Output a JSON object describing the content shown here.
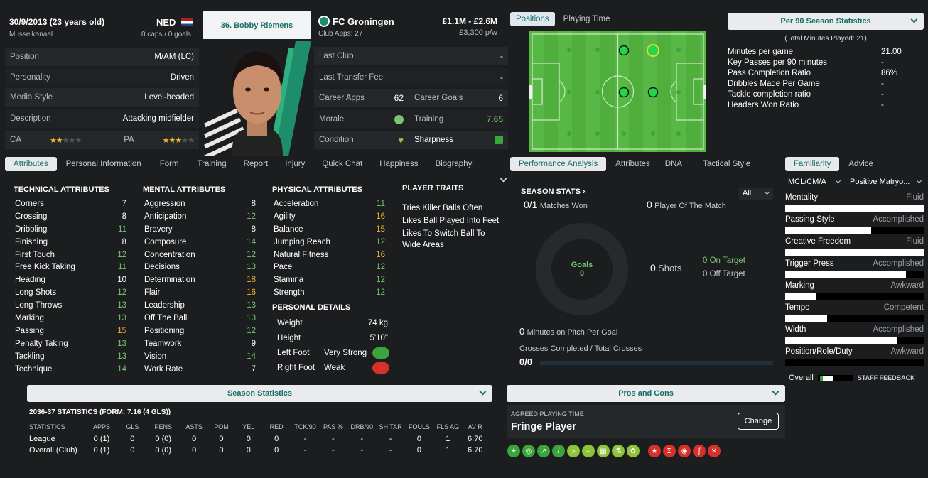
{
  "header": {
    "dob": "30/9/2013 (23 years old)",
    "nation": "NED",
    "birthplace": "Musselkanaal",
    "caps": "0 caps / 0 goals",
    "player_name": "36. Bobby Riemens",
    "club": "FC Groningen",
    "club_apps": "Club Apps: 27",
    "value": "£1.1M - £2.6M",
    "wage": "£3,300 p/w"
  },
  "info_rows": [
    {
      "label": "Position",
      "value": "M/AM (LC)"
    },
    {
      "label": "Personality",
      "value": "Driven"
    },
    {
      "label": "Media Style",
      "value": "Level-headed"
    },
    {
      "label": "Description",
      "value": "Attacking midfielder"
    }
  ],
  "ability": {
    "ca_label": "CA",
    "pa_label": "PA",
    "ca_stars": 2.5,
    "pa_stars": 3.5
  },
  "club_rows": {
    "last_club_label": "Last Club",
    "last_club": "-",
    "last_fee_label": "Last Transfer Fee",
    "last_fee": "-",
    "career_apps_label": "Career Apps",
    "career_apps": "62",
    "career_goals_label": "Career Goals",
    "career_goals": "6",
    "morale_label": "Morale",
    "training_label": "Training",
    "training": "7.65",
    "condition_label": "Condition",
    "sharpness_label": "Sharpness"
  },
  "pitch_tabs": [
    "Positions",
    "Playing Time"
  ],
  "per90": {
    "title": "Per 90 Season Statistics",
    "subtitle": "(Total Minutes Played: 21)",
    "rows": [
      {
        "label": "Minutes per game",
        "value": "21.00"
      },
      {
        "label": "Key Passes per 90 minutes",
        "value": "-"
      },
      {
        "label": "Pass Completion Ratio",
        "value": "86%"
      },
      {
        "label": "Dribbles Made Per Game",
        "value": "-"
      },
      {
        "label": "Tackle completion ratio",
        "value": "-"
      },
      {
        "label": "Headers Won Ratio",
        "value": "-"
      }
    ]
  },
  "tabs": [
    "Attributes",
    "Personal Information",
    "Form",
    "Training",
    "Report",
    "Injury",
    "Quick Chat",
    "Happiness",
    "Biography"
  ],
  "technical": {
    "title": "TECHNICAL ATTRIBUTES",
    "items": [
      {
        "n": "Corners",
        "v": "7"
      },
      {
        "n": "Crossing",
        "v": "8"
      },
      {
        "n": "Dribbling",
        "v": "11"
      },
      {
        "n": "Finishing",
        "v": "8"
      },
      {
        "n": "First Touch",
        "v": "12"
      },
      {
        "n": "Free Kick Taking",
        "v": "11"
      },
      {
        "n": "Heading",
        "v": "10"
      },
      {
        "n": "Long Shots",
        "v": "12"
      },
      {
        "n": "Long Throws",
        "v": "13"
      },
      {
        "n": "Marking",
        "v": "13"
      },
      {
        "n": "Passing",
        "v": "15"
      },
      {
        "n": "Penalty Taking",
        "v": "13"
      },
      {
        "n": "Tackling",
        "v": "13"
      },
      {
        "n": "Technique",
        "v": "14"
      }
    ]
  },
  "mental": {
    "title": "MENTAL ATTRIBUTES",
    "items": [
      {
        "n": "Aggression",
        "v": "8"
      },
      {
        "n": "Anticipation",
        "v": "12"
      },
      {
        "n": "Bravery",
        "v": "8"
      },
      {
        "n": "Composure",
        "v": "14"
      },
      {
        "n": "Concentration",
        "v": "12"
      },
      {
        "n": "Decisions",
        "v": "13"
      },
      {
        "n": "Determination",
        "v": "18"
      },
      {
        "n": "Flair",
        "v": "16"
      },
      {
        "n": "Leadership",
        "v": "13"
      },
      {
        "n": "Off The Ball",
        "v": "13"
      },
      {
        "n": "Positioning",
        "v": "12"
      },
      {
        "n": "Teamwork",
        "v": "9"
      },
      {
        "n": "Vision",
        "v": "14"
      },
      {
        "n": "Work Rate",
        "v": "7"
      }
    ]
  },
  "physical": {
    "title": "PHYSICAL ATTRIBUTES",
    "items": [
      {
        "n": "Acceleration",
        "v": "11"
      },
      {
        "n": "Agility",
        "v": "16"
      },
      {
        "n": "Balance",
        "v": "15"
      },
      {
        "n": "Jumping Reach",
        "v": "12"
      },
      {
        "n": "Natural Fitness",
        "v": "16"
      },
      {
        "n": "Pace",
        "v": "12"
      },
      {
        "n": "Stamina",
        "v": "12"
      },
      {
        "n": "Strength",
        "v": "12"
      }
    ]
  },
  "personal": {
    "title": "PERSONAL DETAILS",
    "weight_label": "Weight",
    "weight": "74 kg",
    "height_label": "Height",
    "height": "5'10\"",
    "left_label": "Left Foot",
    "left": "Very Strong",
    "right_label": "Right Foot",
    "right": "Weak"
  },
  "traits": {
    "title": "PLAYER TRAITS",
    "items": [
      "Tries Killer Balls Often",
      "Likes Ball Played Into Feet",
      "Likes To Switch Ball To Wide Areas"
    ]
  },
  "perf_tabs": [
    "Performance Analysis",
    "Attributes",
    "DNA",
    "Tactical Style"
  ],
  "season_stats": {
    "title": "SEASON STATS",
    "filter": "All",
    "matches_won_v": "0/1",
    "matches_won": "Matches Won",
    "potm_v": "0",
    "potm": "Player Of The Match",
    "goals_label": "Goals",
    "goals": "0",
    "shots_v": "0",
    "shots": "Shots",
    "on_target_v": "0",
    "on_target": "On Target",
    "off_target_v": "0",
    "off_target": "Off Target",
    "mins_goal_v": "0",
    "mins_goal": "Minutes on Pitch Per Goal",
    "crosses_label": "Crosses Completed / Total Crosses",
    "crosses": "0/0"
  },
  "fam_tabs": [
    "Familiarity",
    "Advice"
  ],
  "familiarity": {
    "pos_select": "MCL/CM/A",
    "role_select": "Positive Matryo...",
    "items": [
      {
        "n": "Mentality",
        "v": "Fluid",
        "f": 1.0
      },
      {
        "n": "Passing Style",
        "v": "Accomplished",
        "f": 0.62
      },
      {
        "n": "Creative Freedom",
        "v": "Fluid",
        "f": 1.0
      },
      {
        "n": "Trigger Press",
        "v": "Accomplished",
        "f": 0.87
      },
      {
        "n": "Marking",
        "v": "Awkward",
        "f": 0.22
      },
      {
        "n": "Tempo",
        "v": "Competent",
        "f": 0.3
      },
      {
        "n": "Width",
        "v": "Accomplished",
        "f": 0.81
      },
      {
        "n": "Position/Role/Duty",
        "v": "Awkward",
        "f": 0.0
      }
    ],
    "overall": "Overall",
    "staff_feedback": "STAFF FEEDBACK"
  },
  "season_statistics": {
    "title": "Season Statistics",
    "form": "2036-37 STATISTICS (FORM: 7.16 (4 GLS))",
    "headers": [
      "STATISTICS",
      "APPS",
      "GLS",
      "PENS",
      "ASTS",
      "POM",
      "YEL",
      "RED",
      "TCK/90",
      "PAS %",
      "DRB/90",
      "SH TAR",
      "FOULS",
      "FLS AG",
      "AV R"
    ],
    "rows": [
      [
        "League",
        "0 (1)",
        "0",
        "0 (0)",
        "0",
        "0",
        "0",
        "0",
        "-",
        "-",
        "-",
        "-",
        "0",
        "1",
        "6.70"
      ],
      [
        "Overall (Club)",
        "0 (1)",
        "0",
        "0 (0)",
        "0",
        "0",
        "0",
        "0",
        "-",
        "-",
        "-",
        "-",
        "0",
        "1",
        "6.70"
      ]
    ]
  },
  "pros_cons": {
    "title": "Pros and Cons",
    "agreed_label": "AGREED PLAYING TIME",
    "playing_time": "Fringe Player",
    "change_label": "Change"
  },
  "colors": {
    "accent": "#1a6f6a",
    "positive": "#7ac574",
    "highlight": "#f2b531",
    "pitch": "#4fae3c"
  }
}
